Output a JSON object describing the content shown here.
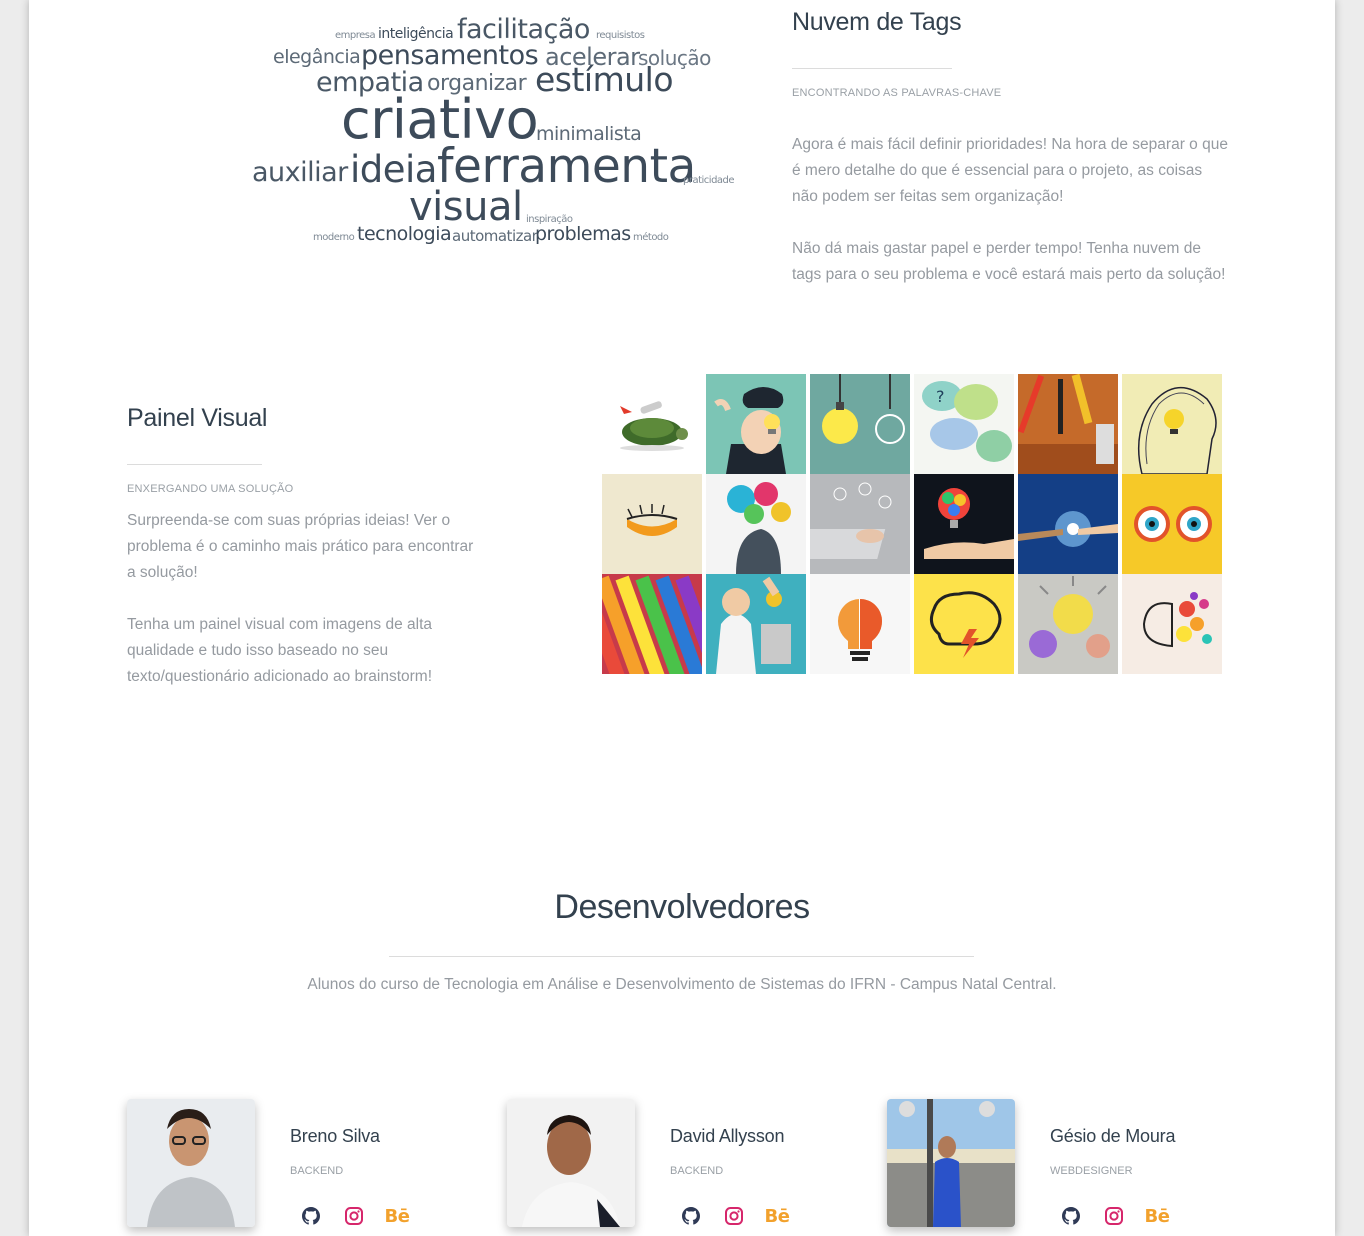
{
  "tag_cloud": {
    "words": [
      {
        "text": "empresa",
        "size": 10,
        "color": "#7f8a95"
      },
      {
        "text": "inteligência",
        "size": 14,
        "color": "#3d4b5a"
      },
      {
        "text": "facilitação",
        "size": 27,
        "color": "#4a5866"
      },
      {
        "text": "requisistos",
        "size": 10,
        "color": "#7f8a95"
      },
      {
        "text": "elegância",
        "size": 19,
        "color": "#5d6a77"
      },
      {
        "text": "pensamentos",
        "size": 27,
        "color": "#3d4b5a"
      },
      {
        "text": "acelerar",
        "size": 24,
        "color": "#5d6a77"
      },
      {
        "text": "solução",
        "size": 20,
        "color": "#6b7784"
      },
      {
        "text": "empatia",
        "size": 27,
        "color": "#4a5866"
      },
      {
        "text": "organizar",
        "size": 22,
        "color": "#5d6a77"
      },
      {
        "text": "estímulo",
        "size": 33,
        "color": "#3d4b5a"
      },
      {
        "text": "criativo",
        "size": 54,
        "color": "#3d4b5a"
      },
      {
        "text": "minimalista",
        "size": 19,
        "color": "#5d6a77"
      },
      {
        "text": "auxiliar",
        "size": 27,
        "color": "#4a5866"
      },
      {
        "text": "ideia",
        "size": 37,
        "color": "#3d4b5a"
      },
      {
        "text": "ferramenta",
        "size": 47,
        "color": "#3d4b5a"
      },
      {
        "text": "praticidade",
        "size": 10,
        "color": "#7f8a95"
      },
      {
        "text": "visual",
        "size": 40,
        "color": "#3d4b5a"
      },
      {
        "text": "inspiração",
        "size": 10,
        "color": "#7f8a95"
      },
      {
        "text": "moderno",
        "size": 10,
        "color": "#7f8a95"
      },
      {
        "text": "tecnologia",
        "size": 19,
        "color": "#3d4b5a"
      },
      {
        "text": "automatizar",
        "size": 15,
        "color": "#5d6a77"
      },
      {
        "text": "problemas",
        "size": 19,
        "color": "#3d4b5a"
      },
      {
        "text": "método",
        "size": 10,
        "color": "#7f8a95"
      }
    ]
  },
  "tags_section": {
    "title": "Nuvem de Tags",
    "kicker": "ENCONTRANDO AS PALAVRAS-CHAVE",
    "p1": "Agora é mais fácil definir prioridades! Na hora de separar o que é mero detalhe do que é essencial para o projeto, as coisas não podem ser feitas sem organização!",
    "p2": "Não dá mais gastar papel e perder tempo! Tenha nuvem de tags para o seu problema e você estará mais perto da solução!"
  },
  "visual_section": {
    "title": "Painel Visual",
    "kicker": "ENXERGANDO UMA SOLUÇÃO",
    "p1": "Surpreenda-se com suas próprias ideias! Ver o problema é o caminho mais prático para encontrar a solução!",
    "p2": "Tenha um painel visual com imagens de alta qualidade e tudo isso baseado no seu texto/questionário adicionado ao brainstorm!"
  },
  "grid_images": [
    {
      "name": "turtle-rocket-image",
      "bg": "#ffffff"
    },
    {
      "name": "head-lightbulb-image",
      "bg": "#7cc5b5"
    },
    {
      "name": "hanging-bulbs-image",
      "bg": "#6fa8a0"
    },
    {
      "name": "bubbles-question-image",
      "bg": "#f4f6f2"
    },
    {
      "name": "tools-belt-image",
      "bg": "#c56a2a"
    },
    {
      "name": "scribble-head-bulb-image",
      "bg": "#f1ecb5"
    },
    {
      "name": "eye-orange-image",
      "bg": "#efe8cf"
    },
    {
      "name": "colorful-splash-head-image",
      "bg": "#f4f4f4"
    },
    {
      "name": "laptop-typing-image",
      "bg": "#b7b9bc"
    },
    {
      "name": "hand-colorful-bulb-image",
      "bg": "#0f141c"
    },
    {
      "name": "robot-human-hands-image",
      "bg": "#143f86"
    },
    {
      "name": "glasses-eyes-image",
      "bg": "#f6c928"
    },
    {
      "name": "color-pencils-image",
      "bg": "#c73a4a"
    },
    {
      "name": "coin-slot-head-image",
      "bg": "#3fb0bf"
    },
    {
      "name": "brain-bulb-icon-image",
      "bg": "#f7f7f7"
    },
    {
      "name": "brain-lightning-image",
      "bg": "#fde24a"
    },
    {
      "name": "crumpled-paper-image",
      "bg": "#c9c9c4"
    },
    {
      "name": "colorful-brain-image",
      "bg": "#f6ece4"
    }
  ],
  "developers": {
    "title": "Desenvolvedores",
    "subtitle": "Alunos do curso de Tecnologia em Análise e Desenvolvimento de Sistemas do IFRN - Campus Natal Central.",
    "members": [
      {
        "name": "Breno Silva",
        "role": "BACKEND"
      },
      {
        "name": "David Allysson",
        "role": "BACKEND"
      },
      {
        "name": "Gésio de Moura",
        "role": "WEBDESIGNER"
      }
    ],
    "social_icons": [
      "github-icon",
      "instagram-icon",
      "behance-icon"
    ],
    "behance_label": "Bē",
    "colors": {
      "github": "#2f3a56",
      "instagram": "#d6266b",
      "behance": "#f2a12c"
    }
  }
}
